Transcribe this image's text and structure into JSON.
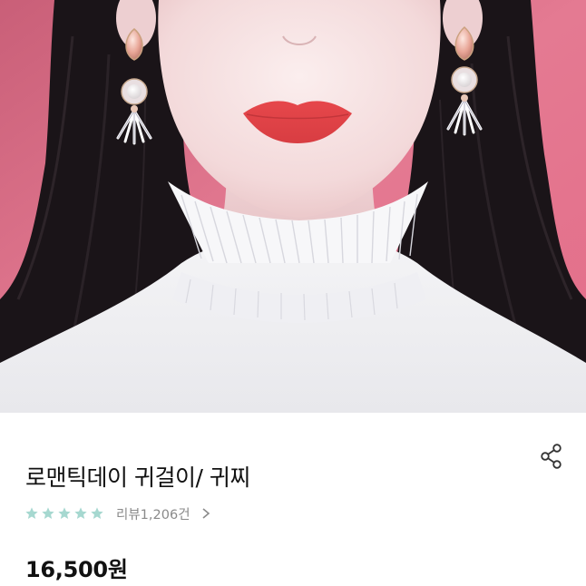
{
  "product": {
    "title": "로맨틱데이 귀걸이/ 귀찌",
    "rating_stars": 5,
    "review_label": "리뷰1,206건",
    "price": "16,500원"
  },
  "icons": {
    "share": "share-icon",
    "star": "star-icon",
    "chevron": "chevron-right-icon"
  },
  "colors": {
    "star": "#a6d8d0",
    "background_photo": "#e2708a",
    "lip": "#e8484c",
    "text_primary": "#111111",
    "text_secondary": "#8a8a8a"
  }
}
